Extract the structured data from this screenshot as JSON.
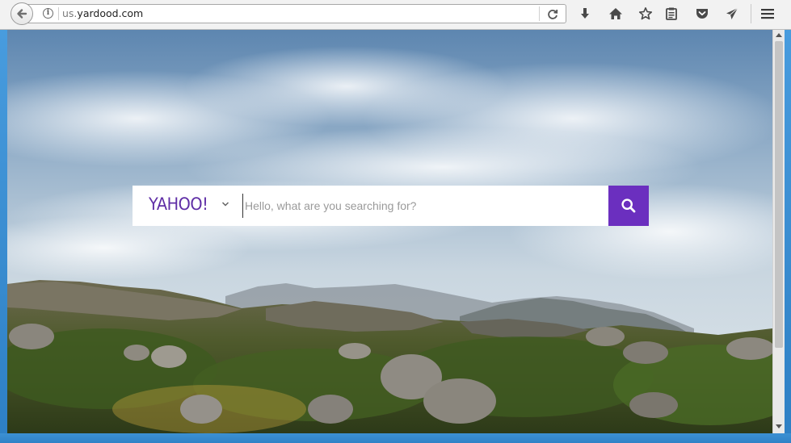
{
  "browser": {
    "url_prefix": "us.",
    "url_domain": "yardood.com",
    "icons": {
      "back": "back-arrow-icon",
      "info": "info-icon",
      "reload": "reload-icon",
      "download": "download-icon",
      "home": "home-icon",
      "bookmark": "star-icon",
      "reading_list": "clipboard-icon",
      "pocket": "pocket-icon",
      "send": "send-icon",
      "menu": "hamburger-menu-icon"
    }
  },
  "page": {
    "logo_text": "YAHOO!",
    "search_placeholder": "Hello, what are you searching for?",
    "search_value": "",
    "accent_color": "#6b2fbf",
    "logo_color": "#5f2ea6"
  }
}
